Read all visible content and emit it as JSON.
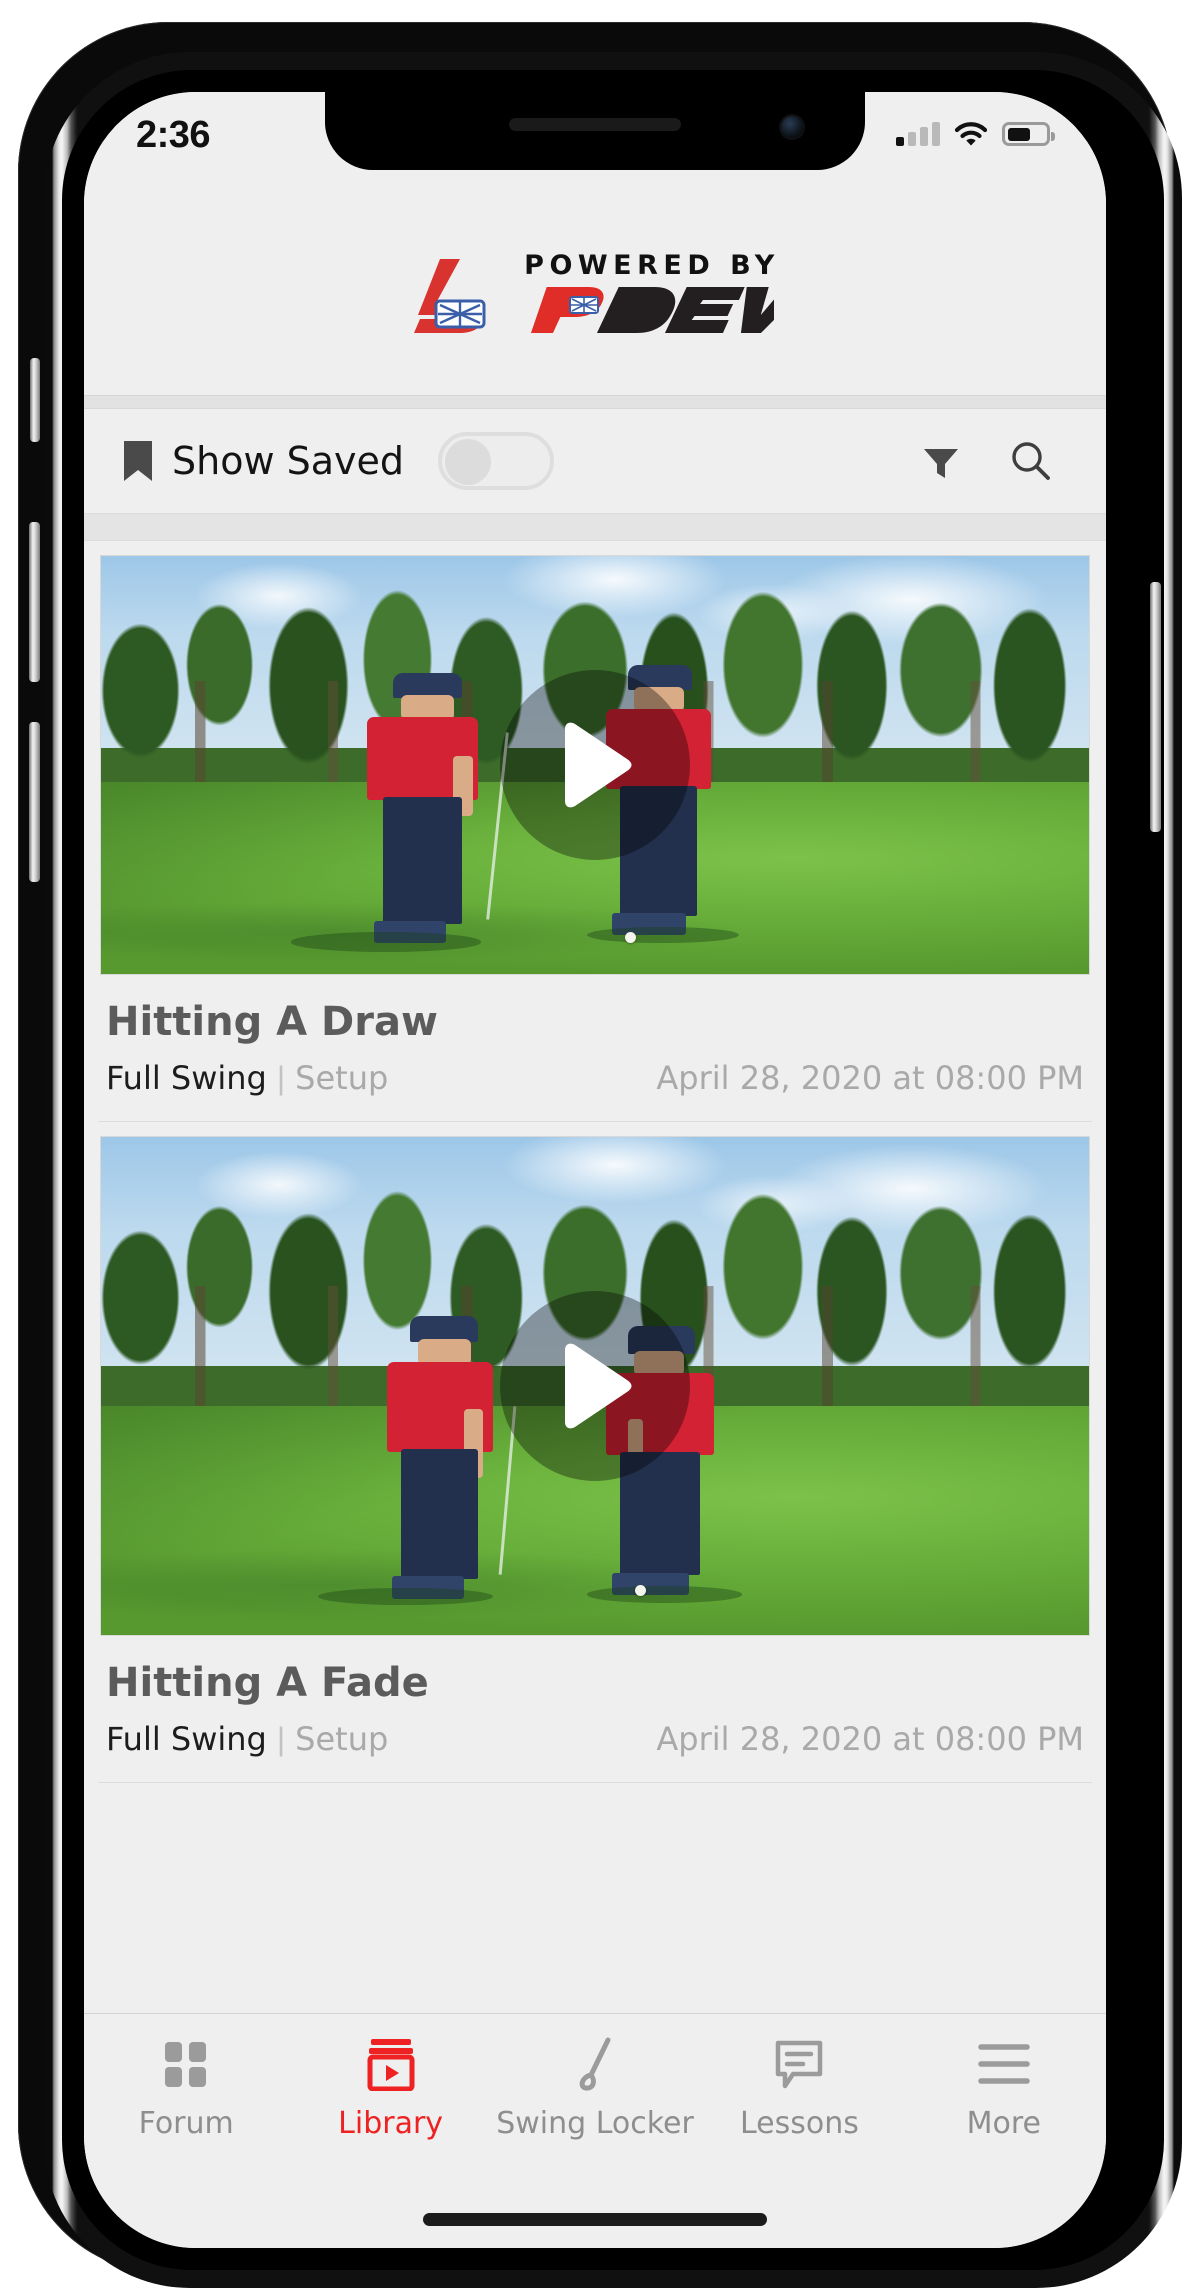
{
  "status_bar": {
    "time": "2:36",
    "signal_icon": "cellular-signal-icon",
    "signal_bars_filled": 1,
    "signal_bars_total": 4,
    "wifi_icon": "wifi-icon",
    "battery_icon": "battery-icon",
    "battery_percent": 62
  },
  "header": {
    "logo_mark": "bp-logo-mark",
    "powered_by": "POWERED BY",
    "brand_p": "P",
    "brand_dev": "DEV"
  },
  "toolbar": {
    "bookmark_icon": "bookmark-icon",
    "show_saved_label": "Show Saved",
    "toggle_state": "off",
    "filter_icon": "filter-icon",
    "search_icon": "search-icon"
  },
  "videos": [
    {
      "title": "Hitting A Draw",
      "category": "Full Swing",
      "separator": "|",
      "subcategory": "Setup",
      "date": "April 28, 2020 at 08:00 PM",
      "play_icon": "play-icon",
      "thumbnail_alt": "two golfers in red shirts on a golf green"
    },
    {
      "title": "Hitting A Fade",
      "category": "Full Swing",
      "separator": "|",
      "subcategory": "Setup",
      "date": "April 28, 2020 at 08:00 PM",
      "play_icon": "play-icon",
      "thumbnail_alt": "two golfers in red shirts lining up a putt"
    }
  ],
  "tab_bar": {
    "active_index": 1,
    "items": [
      {
        "label": "Forum",
        "icon": "grid-squares-icon"
      },
      {
        "label": "Library",
        "icon": "video-library-icon"
      },
      {
        "label": "Swing Locker",
        "icon": "golf-club-icon"
      },
      {
        "label": "Lessons",
        "icon": "chat-bubble-icon"
      },
      {
        "label": "More",
        "icon": "hamburger-menu-icon"
      }
    ]
  },
  "colors": {
    "accent_red": "#ee2222",
    "brand_red": "#e03030",
    "screen_bg": "#efefef",
    "muted_text": "#a9a9a9",
    "title_text": "#5b5b5b"
  }
}
